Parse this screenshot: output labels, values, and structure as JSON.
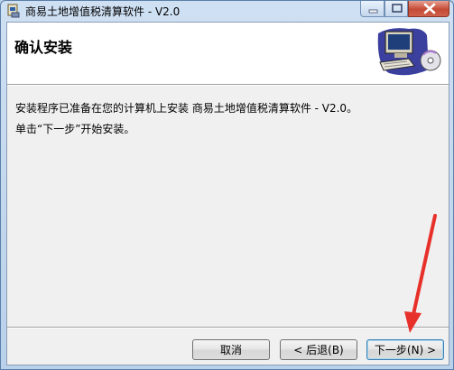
{
  "window": {
    "title": "商易土地增值税清算软件 - V2.0"
  },
  "banner": {
    "heading": "确认安装",
    "art_icon": "computer-setup-icon"
  },
  "body": {
    "line1": "安装程序已准备在您的计算机上安装 商易土地增值税清算软件 - V2.0。",
    "line2": "单击“下一步”开始安装。"
  },
  "buttons": {
    "cancel": "取消",
    "back": "< 后退(B)",
    "next": "下一步(N) >"
  },
  "annotation": {
    "color": "#e8302a",
    "target": "next-button"
  }
}
